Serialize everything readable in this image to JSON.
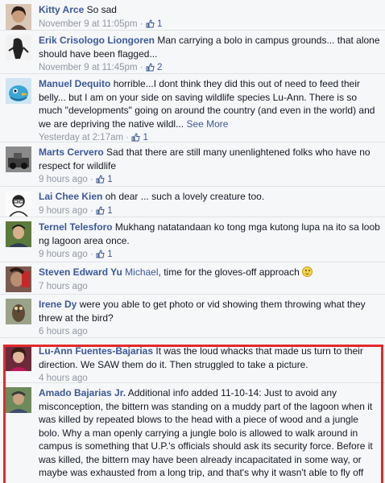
{
  "comments": [
    {
      "name": "Kitty Arce",
      "text": "So sad",
      "time": "November 9 at 11:05pm",
      "likes": "1",
      "avatar": "woman-portrait"
    },
    {
      "name": "Erik Crisologo Liongoren",
      "text": "Man carrying a bolo in campus grounds... that alone should have been flagged...",
      "time": "November 9 at 11:45pm",
      "likes": "2",
      "avatar": "sketch-figure"
    },
    {
      "name": "Manuel Dequito",
      "text": "horrible...I dont think they did this out of need to feed their belly... but I am on your side on saving wildlife species Lu-Ann. There is so much \"developments\" going on around the country (and even in the world) and we are depriving the native wildl...",
      "see_more": "See More",
      "time": "Yesterday at 2:17am",
      "likes": "1",
      "avatar": "blue-bird"
    },
    {
      "name": "Marts Cervero",
      "text": "Sad that there are still many unenlightened folks who have no respect for wildlife",
      "time": "9 hours ago",
      "likes": "1",
      "avatar": "bw-photo"
    },
    {
      "name": "Lai Chee Kien",
      "text": "oh dear ... such a lovely creature too.",
      "time": "9 hours ago",
      "likes": "1",
      "avatar": "man-drawing"
    },
    {
      "name": "Ternel Telesforo",
      "text": "Mukhang natatandaan ko tong mga kutong lupa na ito sa loob ng lagoon area once.",
      "time": "9 hours ago",
      "likes": "1",
      "avatar": "green-portrait"
    },
    {
      "name": "Steven Edward Yu",
      "mention": "Michael",
      "text": ", time for the gloves-off approach",
      "time": "7 hours ago",
      "avatar": "dark-photo"
    },
    {
      "name": "Irene Dy",
      "text": "were you able to get photo or vid showing them throwing what they threw at the bird?",
      "time": "6 hours ago",
      "avatar": "bird-photo"
    },
    {
      "name": "Lu-Ann Fuentes-Bajarias",
      "text": "It was the loud whacks that made us turn to their direction. We SAW them do it. Then struggled to take a picture.",
      "time": "4 hours ago",
      "avatar": "woman-red"
    },
    {
      "name": "Amado Bajarias Jr.",
      "text": "Additional info added 11-10-14: Just to avoid any misconception, the bittern was standing on a muddy part of the lagoon when it was killed by repeated blows to the head with a piece of wood and a jungle bolo. Why a man openly carrying a jungle bolo is allowed to walk around in campus is something that U.P.'s officials should ask its security force. Before it was killed, the bittern may have been already incapacitated in some way, or maybe was exhausted from a long trip, and that's why it wasn't able to fly off",
      "avatar": "man-outdoor"
    }
  ],
  "colors": {
    "link": "#3b5998",
    "meta": "#9197a3",
    "highlight": "#e02b2b",
    "bg": "#f6f7f9"
  }
}
